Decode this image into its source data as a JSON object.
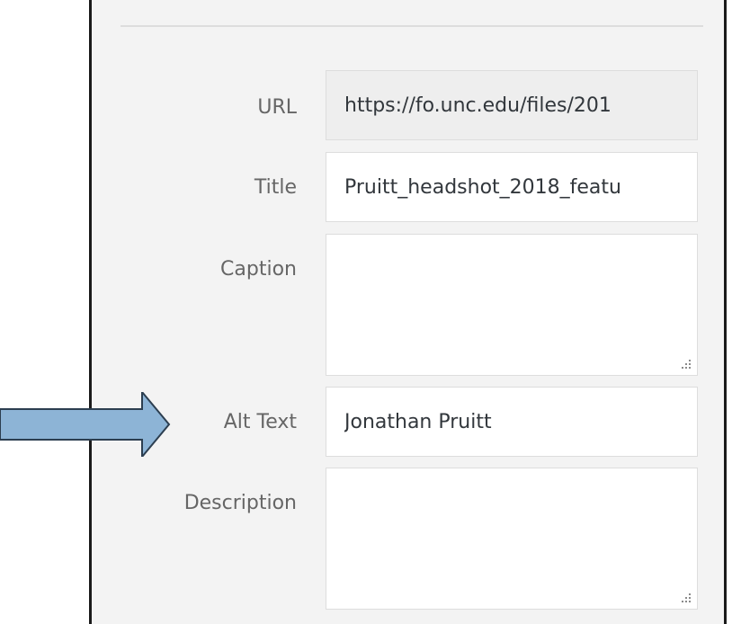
{
  "attachment_details": {
    "fields": [
      {
        "key": "url",
        "label": "URL",
        "value": "https://fo.unc.edu/files/201"
      },
      {
        "key": "title",
        "label": "Title",
        "value": "Pruitt_headshot_2018_featu"
      },
      {
        "key": "caption",
        "label": "Caption",
        "value": ""
      },
      {
        "key": "alt_text",
        "label": "Alt Text",
        "value": "Jonathan Pruitt"
      },
      {
        "key": "description",
        "label": "Description",
        "value": ""
      }
    ]
  },
  "annotation": {
    "arrow_color": "#8db4d6",
    "arrow_target": "alt_text"
  }
}
